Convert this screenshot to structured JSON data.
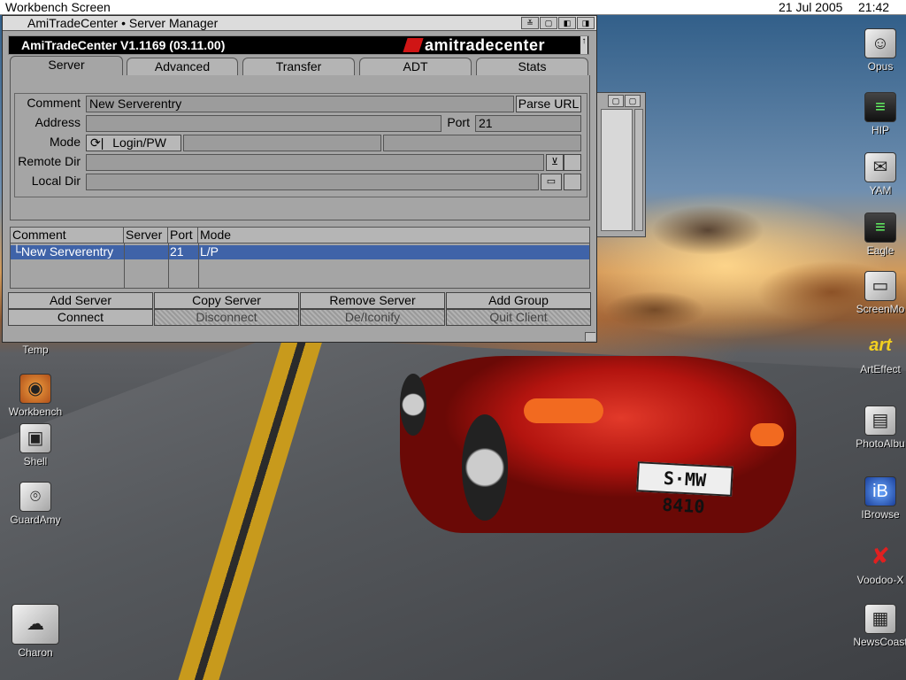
{
  "screen": {
    "title": "Workbench Screen",
    "date": "21 Jul 2005",
    "time": "21:42"
  },
  "window": {
    "title": "AmiTradeCenter • Server Manager",
    "version": "AmiTradeCenter V1.1169 (03.11.00)",
    "logo_text": "amitradecenter",
    "tabs": [
      "Server",
      "Advanced",
      "Transfer",
      "ADT",
      "Stats"
    ],
    "active_tab": "Server"
  },
  "form": {
    "comment_label": "Comment",
    "comment_value": "New Serverentry",
    "parse_url_label": "Parse URL",
    "address_label": "Address",
    "address_value": "",
    "port_label": "Port",
    "port_value": "21",
    "mode_label": "Mode",
    "mode_value": "Login/PW",
    "remote_dir_label": "Remote Dir",
    "remote_dir_value": "",
    "local_dir_label": "Local Dir",
    "local_dir_value": ""
  },
  "server_list": {
    "columns": [
      "Comment",
      "Server",
      "Port",
      "Mode"
    ],
    "rows": [
      {
        "comment": "└New Serverentry",
        "server": "",
        "port": "21",
        "mode": "L/P"
      }
    ]
  },
  "actions": {
    "add_server": "Add Server",
    "copy_server": "Copy Server",
    "remove_server": "Remove Server",
    "add_group": "Add Group",
    "connect": "Connect",
    "disconnect": "Disconnect",
    "deiconify": "De/Iconify",
    "quit_client": "Quit Client"
  },
  "car_plate": "S·MW 8410",
  "desktop_icons_left": [
    {
      "name": "Temp",
      "icon": "drawer-icon"
    },
    {
      "name": "Workbench",
      "icon": "disk-stack-icon"
    },
    {
      "name": "Shell",
      "icon": "shell-icon"
    },
    {
      "name": "GuardAmy",
      "icon": "satellite-dish-icon"
    },
    {
      "name": "Charon",
      "icon": "charon-icon"
    }
  ],
  "desktop_icons_right": [
    {
      "name": "Opus",
      "icon": "opus-icon"
    },
    {
      "name": "HIP",
      "icon": "hip-icon"
    },
    {
      "name": "YAM",
      "icon": "mail-icon"
    },
    {
      "name": "Eagle",
      "icon": "eagle-icon"
    },
    {
      "name": "ScreenMo",
      "icon": "monitor-icon"
    },
    {
      "name": "ArtEffect",
      "icon": "art-effect-icon"
    },
    {
      "name": "PhotoAlbu",
      "icon": "photo-album-icon"
    },
    {
      "name": "IBrowse",
      "icon": "ibrowse-icon"
    },
    {
      "name": "Voodoo-X",
      "icon": "wrench-icon"
    },
    {
      "name": "NewsCoast",
      "icon": "newspaper-icon"
    }
  ],
  "colors": {
    "selection": "#3f63a8",
    "window_bg": "#a5a5a5",
    "logo_red": "#d01515"
  }
}
